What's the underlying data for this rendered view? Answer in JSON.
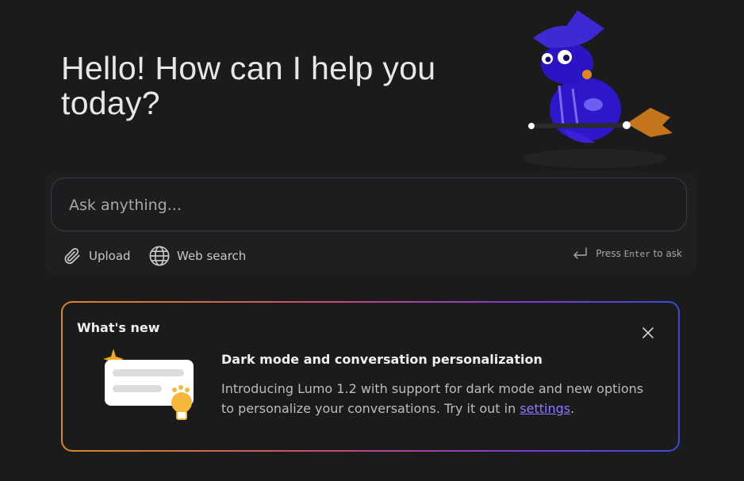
{
  "greeting": "Hello! How can I help you today?",
  "composer": {
    "placeholder": "Ask anything...",
    "upload_label": "Upload",
    "web_search_label": "Web search",
    "enter_hint_prefix": "Press ",
    "enter_hint_key": "Enter",
    "enter_hint_suffix": " to ask"
  },
  "whats_new": {
    "title": "What's new",
    "headline": "Dark mode and conversation personalization",
    "body_prefix": "Introducing Lumo 1.2 with support for dark mode and new options to personalize your conversations. Try it out in ",
    "link_label": "settings",
    "body_suffix": "."
  },
  "icons": {
    "upload": "paperclip-icon",
    "web_search": "globe-icon",
    "enter": "enter-arrow-icon",
    "close": "close-icon"
  },
  "colors": {
    "background": "#1b1b1c",
    "link": "#8b7cff",
    "gradient_start": "#d9891f",
    "gradient_end": "#3a4bd9",
    "mascot": "#3a1fd0"
  }
}
